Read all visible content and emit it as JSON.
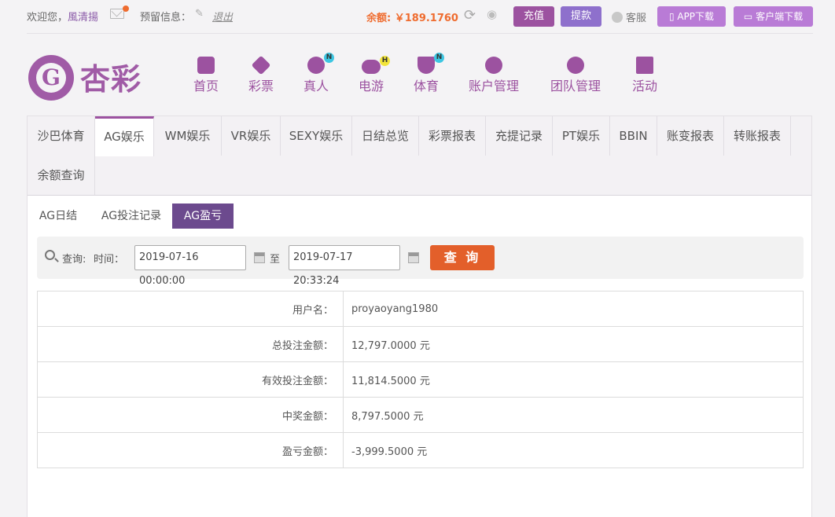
{
  "topbar": {
    "welcome_prefix": "欢迎您，",
    "username": "風清揚",
    "reserve_label": "预留信息：",
    "logout": "退出",
    "balance": "余额: ￥189.1760",
    "recharge": "充值",
    "withdraw": "提款",
    "service": "客服",
    "app_download": "APP下载",
    "client_download": "客户端下载"
  },
  "header": {
    "logo_text": "杏彩",
    "nav": [
      {
        "label": "首页",
        "badge": ""
      },
      {
        "label": "彩票",
        "badge": ""
      },
      {
        "label": "真人",
        "badge": "N"
      },
      {
        "label": "电游",
        "badge": "H"
      },
      {
        "label": "体育",
        "badge": "N"
      },
      {
        "label": "账户管理",
        "badge": ""
      },
      {
        "label": "团队管理",
        "badge": ""
      },
      {
        "label": "活动",
        "badge": ""
      }
    ]
  },
  "tabs": [
    "沙巴体育",
    "AG娱乐",
    "WM娱乐",
    "VR娱乐",
    "SEXY娱乐",
    "日结总览",
    "彩票报表",
    "充提记录",
    "PT娱乐",
    "BBIN",
    "账变报表",
    "转账报表",
    "余额查询"
  ],
  "subtabs": [
    "AG日结",
    "AG投注记录",
    "AG盈亏"
  ],
  "query": {
    "label": "查询:",
    "time_label": "时间：",
    "start": "2019-07-16 00:00:00",
    "to": "至",
    "end": "2019-07-17 20:33:24",
    "button": "查 询"
  },
  "result": {
    "rows": [
      {
        "key": "用户名：",
        "value": "proyaoyang1980"
      },
      {
        "key": "总投注金额：",
        "value": "12,797.0000 元"
      },
      {
        "key": "有效投注金额：",
        "value": "11,814.5000 元"
      },
      {
        "key": "中奖金额：",
        "value": "8,797.5000 元"
      },
      {
        "key": "盈亏金额：",
        "value": "-3,999.5000 元"
      }
    ]
  },
  "colors": {
    "brand": "#9c52a0",
    "accent": "#ef6c2f",
    "active_subtab": "#6c4a8e"
  }
}
